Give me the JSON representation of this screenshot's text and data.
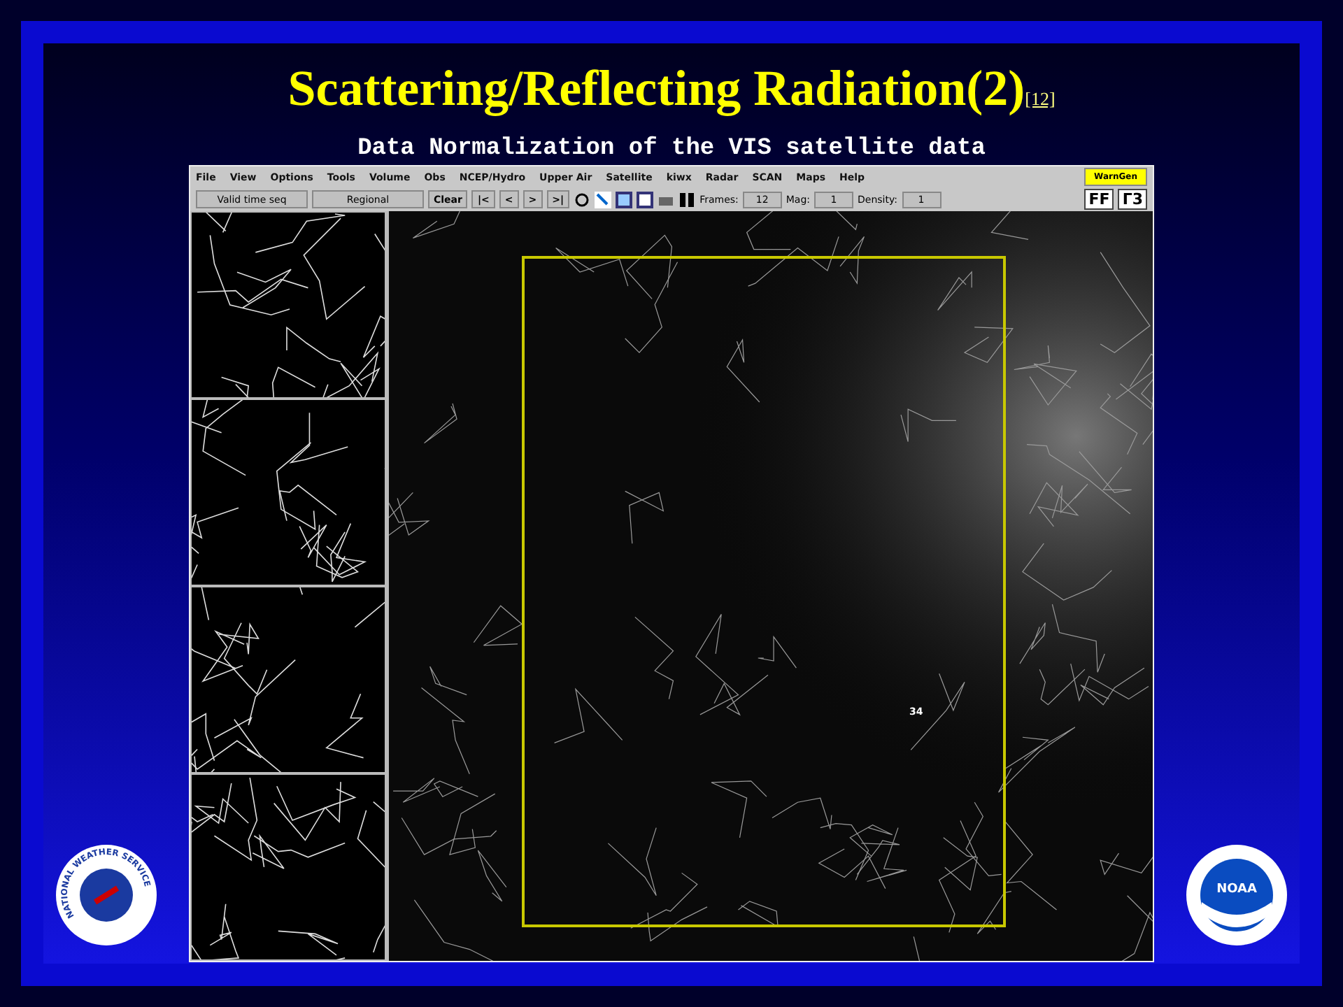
{
  "slide": {
    "title": "Scattering/Reflecting Radiation(2)",
    "title_ref": "[12]",
    "subtitle": "Data Normalization of the VIS satellite data"
  },
  "app": {
    "menu": [
      "File",
      "View",
      "Options",
      "Tools",
      "Volume",
      "Obs",
      "NCEP/Hydro",
      "Upper Air",
      "Satellite",
      "kiwx",
      "Radar",
      "SCAN",
      "Maps",
      "Help"
    ],
    "warning_button": "WarnGen",
    "toolbar": {
      "dropdowns": [
        "Valid time seq",
        "Regional"
      ],
      "clear": "Clear",
      "nav": [
        "|<",
        "<",
        ">",
        ">|"
      ],
      "fields": [
        {
          "label": "Frames:",
          "value": "12"
        },
        {
          "label": "Mag:",
          "value": "1"
        },
        {
          "label": "Density:",
          "value": "1"
        }
      ],
      "right_buttons": [
        "FF",
        "Γ3"
      ]
    },
    "map_label": "34"
  },
  "logos": {
    "left": "NATIONAL WEATHER SERVICE",
    "right": "NOAA"
  }
}
